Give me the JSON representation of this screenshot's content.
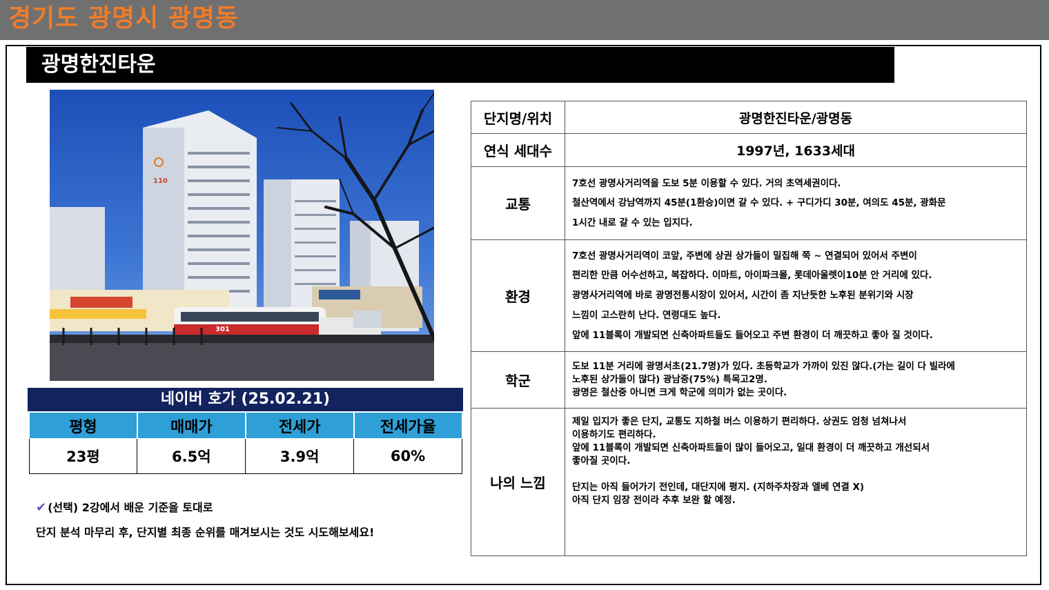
{
  "header": {
    "region": "경기도 광명시 광명동"
  },
  "complex": {
    "name": "광명한진타운"
  },
  "photo": {
    "sign_text": "110",
    "bus_number": "301"
  },
  "naver": {
    "title": "네이버 호가 (25.02.21)",
    "columns": [
      "평형",
      "매매가",
      "전세가",
      "전세가율"
    ],
    "row": [
      "23평",
      "6.5억",
      "3.9억",
      "60%"
    ]
  },
  "note": {
    "line1": "(선택) 2강에서 배운 기준을 토대로",
    "line2": "단지 분석 마무리 후, 단지별 최종 순위를 매겨보시는 것도 시도해보세요!"
  },
  "info": {
    "location": {
      "label": "단지명/위치",
      "value": "광명한진타운/광명동"
    },
    "year": {
      "label": "연식 세대수",
      "value": "1997년, 1633세대"
    },
    "transport": {
      "label": "교통",
      "lines": [
        "7호선 광명사거리역을 도보 5분 이용할 수 있다. 거의 초역세권이다.",
        "철산역에서 강남역까지 45분(1환승)이면 갈 수 있다.  + 구디가디 30분, 여의도 45분, 광화문",
        "1시간 내로 갈 수 있는 입지다."
      ]
    },
    "environment": {
      "label": "환경",
      "lines": [
        "7호선 광명사거리역이 코앞, 주변에 상권 상가들이 밀집해 쭉 ~  연결되어 있어서 주변이",
        "편리한 만큼 어수선하고, 복잡하다.  이마트, 아이파크몰, 롯데아울렛이10분 안 거리에 있다.",
        "광명사거리역에 바로 광명전통시장이 있어서,  시간이 좀 지난듯한 노후된 분위기와 시장",
        "느낌이 고스란히 난다.  연령대도 높다.",
        "앞에 11블록이 개발되면 신축아파트들도 들어오고 주변 환경이 더 깨끗하고 좋아 질 것이다."
      ]
    },
    "school": {
      "label": "학군",
      "lines": [
        "도보 11분 거리에 광명서초(21.7명)가 있다. 초등학교가 가까이 있진 않다.(가는 길이 다 빌라에",
        "노후된 상가들이 많다) 광남중(75%) 특목고2명.",
        "광명은 철산중 아니면 크게 학군에 의미가 없는 곳이다."
      ]
    },
    "feeling": {
      "label": "나의 느낌",
      "lines": [
        " 제일 입지가 좋은 단지, 교통도 지하철 버스 이용하기 편리하다. 상권도 엄청 넘쳐나서",
        "이용하기도 편리하다.",
        "앞에 11블록이 개발되면 신축아파트들이 많이 들어오고, 일대 환경이 더 깨끗하고 개선되서",
        "좋아질 곳이다.",
        "",
        "단지는 아직 들어가기 전인데, 대단지에 평지. (지하주차장과 엘베 연결 X)",
        "아직 단지 임장 전이라 추후 보완 할 예정."
      ]
    }
  },
  "colors": {
    "header_bg": "#707070",
    "header_text": "#f07c2a",
    "naver_head": "#13235e",
    "naver_cols": "#2e9fd7",
    "check": "#6b4fc2"
  }
}
